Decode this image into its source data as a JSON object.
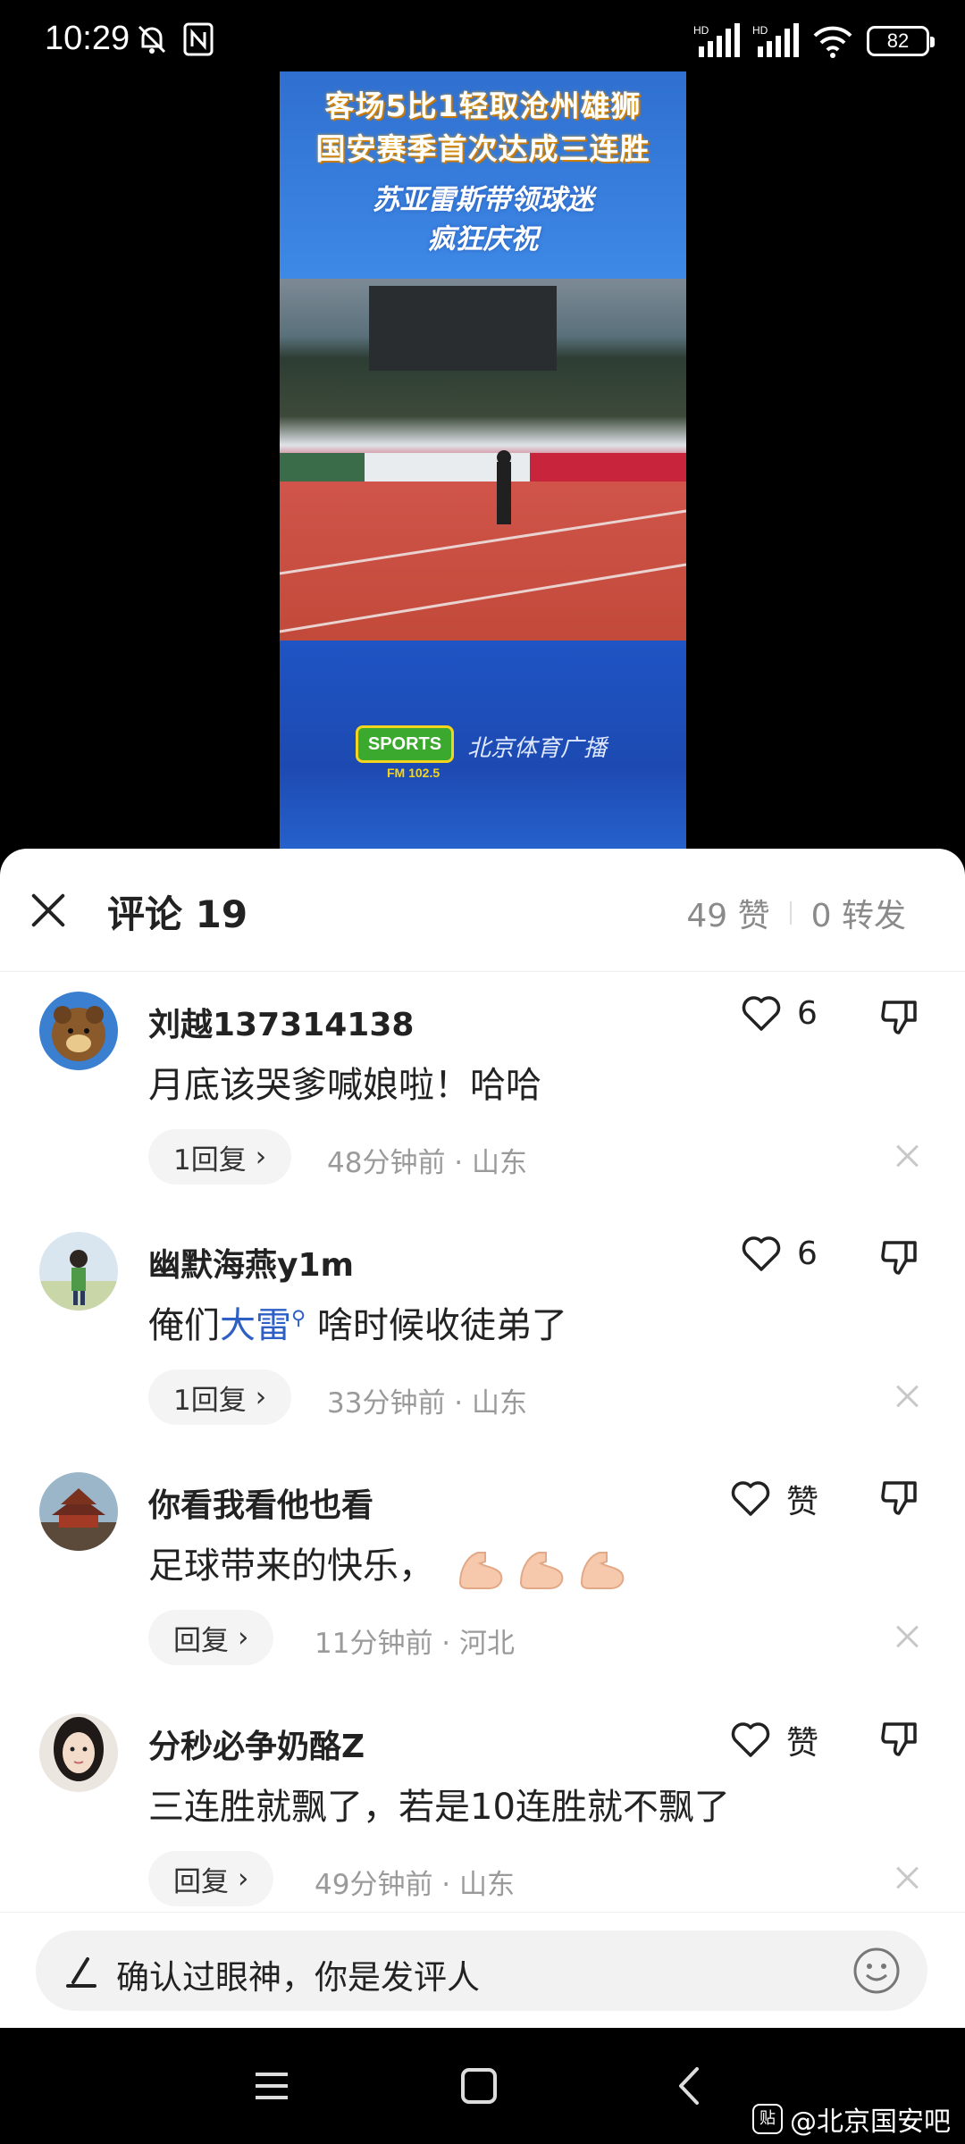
{
  "status_bar": {
    "time": "10:29",
    "battery": "82",
    "hd1": "HD",
    "hd2": "HD"
  },
  "video": {
    "headline_1": "客场5比1轻取沧州雄狮",
    "headline_2": "国安赛季首次达成三连胜",
    "subline_1": "苏亚雷斯带领球迷",
    "subline_2": "疯狂庆祝",
    "logo_text": "SPORTS",
    "logo_fm": "FM 102.5",
    "radio_name": "北京体育广播"
  },
  "comments_header": {
    "title": "评论 19",
    "likes": "49 赞",
    "reposts": "0 转发"
  },
  "comments": [
    {
      "username": "刘越137314138",
      "text": "月底该哭爹喊娘啦！哈哈",
      "like_label": "6",
      "reply_label": "1回复",
      "time_location": "48分钟前 · 山东"
    },
    {
      "username": "幽默海燕y1m",
      "text_before": "俺们",
      "mention": "大雷",
      "text_after": " 啥时候收徒弟了",
      "like_label": "6",
      "reply_label": "1回复",
      "time_location": "33分钟前 · 山东"
    },
    {
      "username": "你看我看他也看",
      "text": "足球带来的快乐，",
      "like_label": "赞",
      "reply_label": "回复",
      "time_location": "11分钟前 · 河北"
    },
    {
      "username": "分秒必争奶酪Z",
      "text": "三连胜就飘了，若是10连胜就不飘了",
      "like_label": "赞",
      "reply_label": "回复",
      "time_location": "49分钟前 · 山东"
    }
  ],
  "input": {
    "placeholder": "确认过眼神，你是发评人"
  },
  "watermark": {
    "badge": "贴",
    "text": "@北京国安吧"
  },
  "colors": {
    "link": "#2d5fc4",
    "meta_gray": "#9a9a9a",
    "video_blue": "#1f54c4"
  }
}
